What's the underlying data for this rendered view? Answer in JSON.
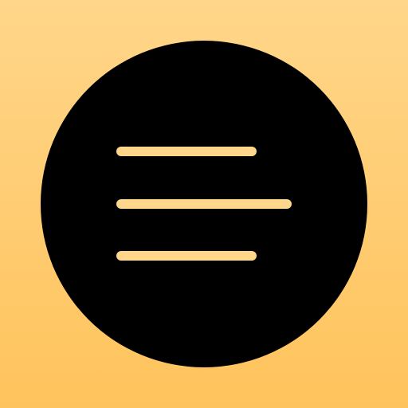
{
  "icon": {
    "name": "menu-lines-icon",
    "colors": {
      "background_top": "#FFD68A",
      "background_bottom": "#FFC35C",
      "circle": "#000000",
      "lines": "#FFD68A"
    }
  }
}
